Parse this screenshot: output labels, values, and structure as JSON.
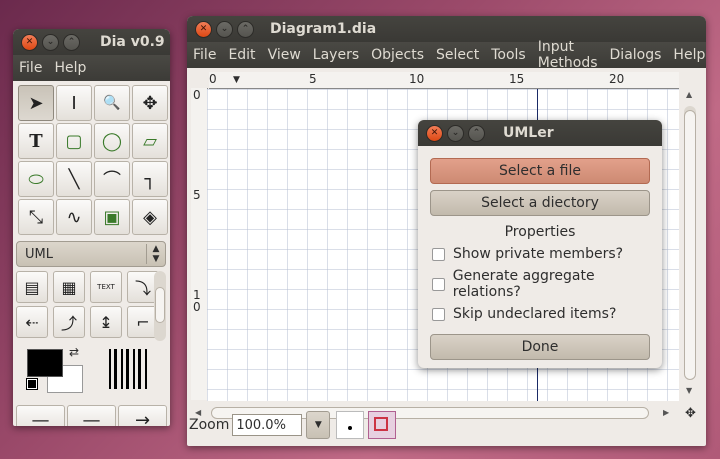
{
  "toolbox": {
    "title": "Dia v0.9",
    "menu": [
      "File",
      "Help"
    ],
    "tools": [
      {
        "icon": "pointer-icon",
        "glyph": "➤"
      },
      {
        "icon": "text-cursor-icon",
        "glyph": "I"
      },
      {
        "icon": "magnify-icon",
        "glyph": "🔍"
      },
      {
        "icon": "move-icon",
        "glyph": "✥"
      },
      {
        "icon": "text-tool-icon",
        "glyph": "T"
      },
      {
        "icon": "box-icon",
        "glyph": "▢"
      },
      {
        "icon": "ellipse-icon",
        "glyph": "◯"
      },
      {
        "icon": "polygon-icon",
        "glyph": "▱"
      },
      {
        "icon": "beziergon-icon",
        "glyph": "⬭"
      },
      {
        "icon": "line-icon",
        "glyph": "╲"
      },
      {
        "icon": "arc-icon",
        "glyph": "⌒"
      },
      {
        "icon": "zigzag-line-icon",
        "glyph": "┐"
      },
      {
        "icon": "polyline-icon",
        "glyph": "⤡"
      },
      {
        "icon": "bezier-line-icon",
        "glyph": "∿"
      },
      {
        "icon": "image-icon",
        "glyph": "▣"
      },
      {
        "icon": "outline-icon",
        "glyph": "◈"
      }
    ],
    "sheet": "UML",
    "uml_tools": [
      {
        "icon": "uml-class-icon",
        "glyph": "▤"
      },
      {
        "icon": "uml-template-class-icon",
        "glyph": "▦"
      },
      {
        "icon": "uml-note-icon",
        "glyph": "TEXT"
      },
      {
        "icon": "uml-dependency-icon",
        "glyph": "⤵"
      },
      {
        "icon": "uml-realizes-icon",
        "glyph": "⇠"
      },
      {
        "icon": "uml-generalization-icon",
        "glyph": "⤴"
      },
      {
        "icon": "uml-implements-icon",
        "glyph": "↨"
      },
      {
        "icon": "uml-constraint-icon",
        "glyph": "⌐"
      }
    ],
    "arrows": [
      "—",
      "—",
      "→"
    ]
  },
  "diagram": {
    "title": "Diagram1.dia",
    "menu": [
      "File",
      "Edit",
      "View",
      "Layers",
      "Objects",
      "Select",
      "Tools",
      "Input Methods",
      "Dialogs",
      "Help"
    ],
    "hruler_labels": [
      "0",
      "5",
      "10",
      "15",
      "20"
    ],
    "vruler_labels": [
      "0",
      "5",
      "1",
      "0"
    ],
    "zoom_label": "Zoom",
    "zoom_value": "100.0%"
  },
  "umler": {
    "title": "UMLer",
    "select_file": "Select a file",
    "select_directory": "Select a diectory",
    "properties": "Properties",
    "options": [
      "Show private members?",
      "Generate aggregate relations?",
      "Skip undeclared items?"
    ],
    "done": "Done"
  }
}
